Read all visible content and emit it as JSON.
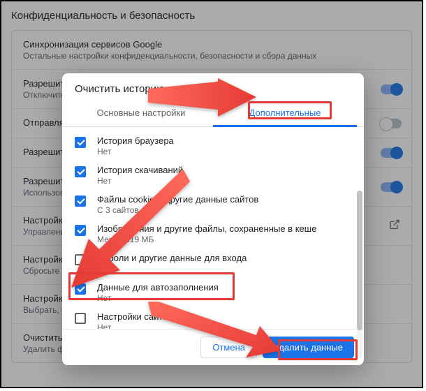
{
  "page": {
    "title": "Конфиденциальность и безопасность"
  },
  "rows": [
    {
      "title": "Синхронизация сервисов Google",
      "sub": "Остальные настройки конфиденциальности, безопасности и сбора данных"
    },
    {
      "title": "Разрешить вход",
      "sub": "Отключите эту функцию, если необходимо"
    },
    {
      "title": "Отправлять запрет отслеживания",
      "sub": ""
    },
    {
      "title": "Разрешить сайтам проверять способы оплаты",
      "sub": ""
    },
    {
      "title": "Разрешить",
      "sub": "Использовать в браузере и открывать страницы"
    },
    {
      "title": "Настройки",
      "sub": "Управление"
    },
    {
      "title": "Настройки",
      "sub": "Сбросьте параметры"
    },
    {
      "title": "Настройки",
      "sub": "Выбрать, какие данные"
    },
    {
      "title": "Очистить историю",
      "sub": "Удалить файлы cookie и данные сайтов, очистить историю и кеш"
    }
  ],
  "dialog": {
    "title": "Очистить историю",
    "tabs": {
      "basic": "Основные настройки",
      "advanced": "Дополнительные"
    },
    "items": [
      {
        "checked": true,
        "title": "История браузера",
        "sub": "Нет"
      },
      {
        "checked": true,
        "title": "История скачиваний",
        "sub": "Нет"
      },
      {
        "checked": true,
        "title": "Файлы cookie и другие данные сайтов",
        "sub": "С 3 сайтов"
      },
      {
        "checked": true,
        "title": "Изображения и другие файлы, сохраненные в кеше",
        "sub": "Менее 319 МБ"
      },
      {
        "checked": false,
        "title": "Пароли и другие данные для входа",
        "sub": "Нет"
      },
      {
        "checked": true,
        "title": "Данные для автозаполнения",
        "sub": "Нет"
      },
      {
        "checked": false,
        "title": "Настройки сайта",
        "sub": "Нет"
      }
    ],
    "cancel": "Отмена",
    "confirm": "Удалить данные"
  }
}
